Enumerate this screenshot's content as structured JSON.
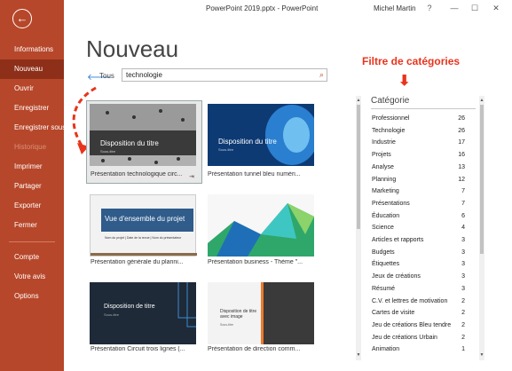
{
  "window": {
    "title": "PowerPoint 2019.pptx  -  PowerPoint",
    "user": "Michel Martin",
    "help": "?",
    "minimize": "—",
    "maximize": "☐",
    "close": "✕"
  },
  "sidebar": {
    "back_glyph": "←",
    "items": [
      {
        "label": "Informations"
      },
      {
        "label": "Nouveau"
      },
      {
        "label": "Ouvrir"
      },
      {
        "label": "Enregistrer"
      },
      {
        "label": "Enregistrer sous"
      },
      {
        "label": "Historique"
      },
      {
        "label": "Imprimer"
      },
      {
        "label": "Partager"
      },
      {
        "label": "Exporter"
      },
      {
        "label": "Fermer"
      },
      {
        "label": "Compte"
      },
      {
        "label": "Votre avis"
      },
      {
        "label": "Options"
      }
    ]
  },
  "main": {
    "heading": "Nouveau",
    "back_glyph": "🡐",
    "back_label": "Tous",
    "search_value": "technologie",
    "search_icon": "⌕",
    "annotation": "Filtre de catégories",
    "annotation_arrow": "⬇",
    "pin_glyph": "⇥"
  },
  "templates": [
    {
      "label": "Présentation technologique circ...",
      "thumb_title": "Disposition du titre",
      "thumb_sub": "Sous-titre"
    },
    {
      "label": "Présentation tunnel bleu numéri...",
      "thumb_title": "Disposition du titre",
      "thumb_sub": "Sous-titre"
    },
    {
      "label": "Présentation générale du planni...",
      "thumb_title": "Vue d'ensemble du projet",
      "thumb_sub": "Nom du projet  |  Date de la revue  |  Nom du présentateur"
    },
    {
      "label": "Présentation business - Thème \"...",
      "thumb_title": "",
      "thumb_sub": ""
    },
    {
      "label": "Présentation Circuit trois lignes (...",
      "thumb_title": "Disposition de titre",
      "thumb_sub": "Sous-titre"
    },
    {
      "label": "Présentation de direction comm...",
      "thumb_title": "Disposition de titre avec image",
      "thumb_sub": "Sous-titre"
    }
  ],
  "categories": {
    "heading": "Catégorie",
    "items": [
      {
        "name": "Professionnel",
        "count": "26"
      },
      {
        "name": "Technologie",
        "count": "26"
      },
      {
        "name": "Industrie",
        "count": "17"
      },
      {
        "name": "Projets",
        "count": "16"
      },
      {
        "name": "Analyse",
        "count": "13"
      },
      {
        "name": "Planning",
        "count": "12"
      },
      {
        "name": "Marketing",
        "count": "7"
      },
      {
        "name": "Présentations",
        "count": "7"
      },
      {
        "name": "Éducation",
        "count": "6"
      },
      {
        "name": "Science",
        "count": "4"
      },
      {
        "name": "Articles et rapports",
        "count": "3"
      },
      {
        "name": "Budgets",
        "count": "3"
      },
      {
        "name": "Étiquettes",
        "count": "3"
      },
      {
        "name": "Jeux de créations",
        "count": "3"
      },
      {
        "name": "Résumé",
        "count": "3"
      },
      {
        "name": "C.V. et lettres de motivation",
        "count": "2"
      },
      {
        "name": "Cartes de visite",
        "count": "2"
      },
      {
        "name": "Jeu de créations Bleu tendre",
        "count": "2"
      },
      {
        "name": "Jeu de créations Urbain",
        "count": "2"
      },
      {
        "name": "Animation",
        "count": "1"
      }
    ]
  },
  "colors": {
    "sidebar": "#b7472a",
    "active": "#8e2f19",
    "accent": "#e8341c"
  }
}
